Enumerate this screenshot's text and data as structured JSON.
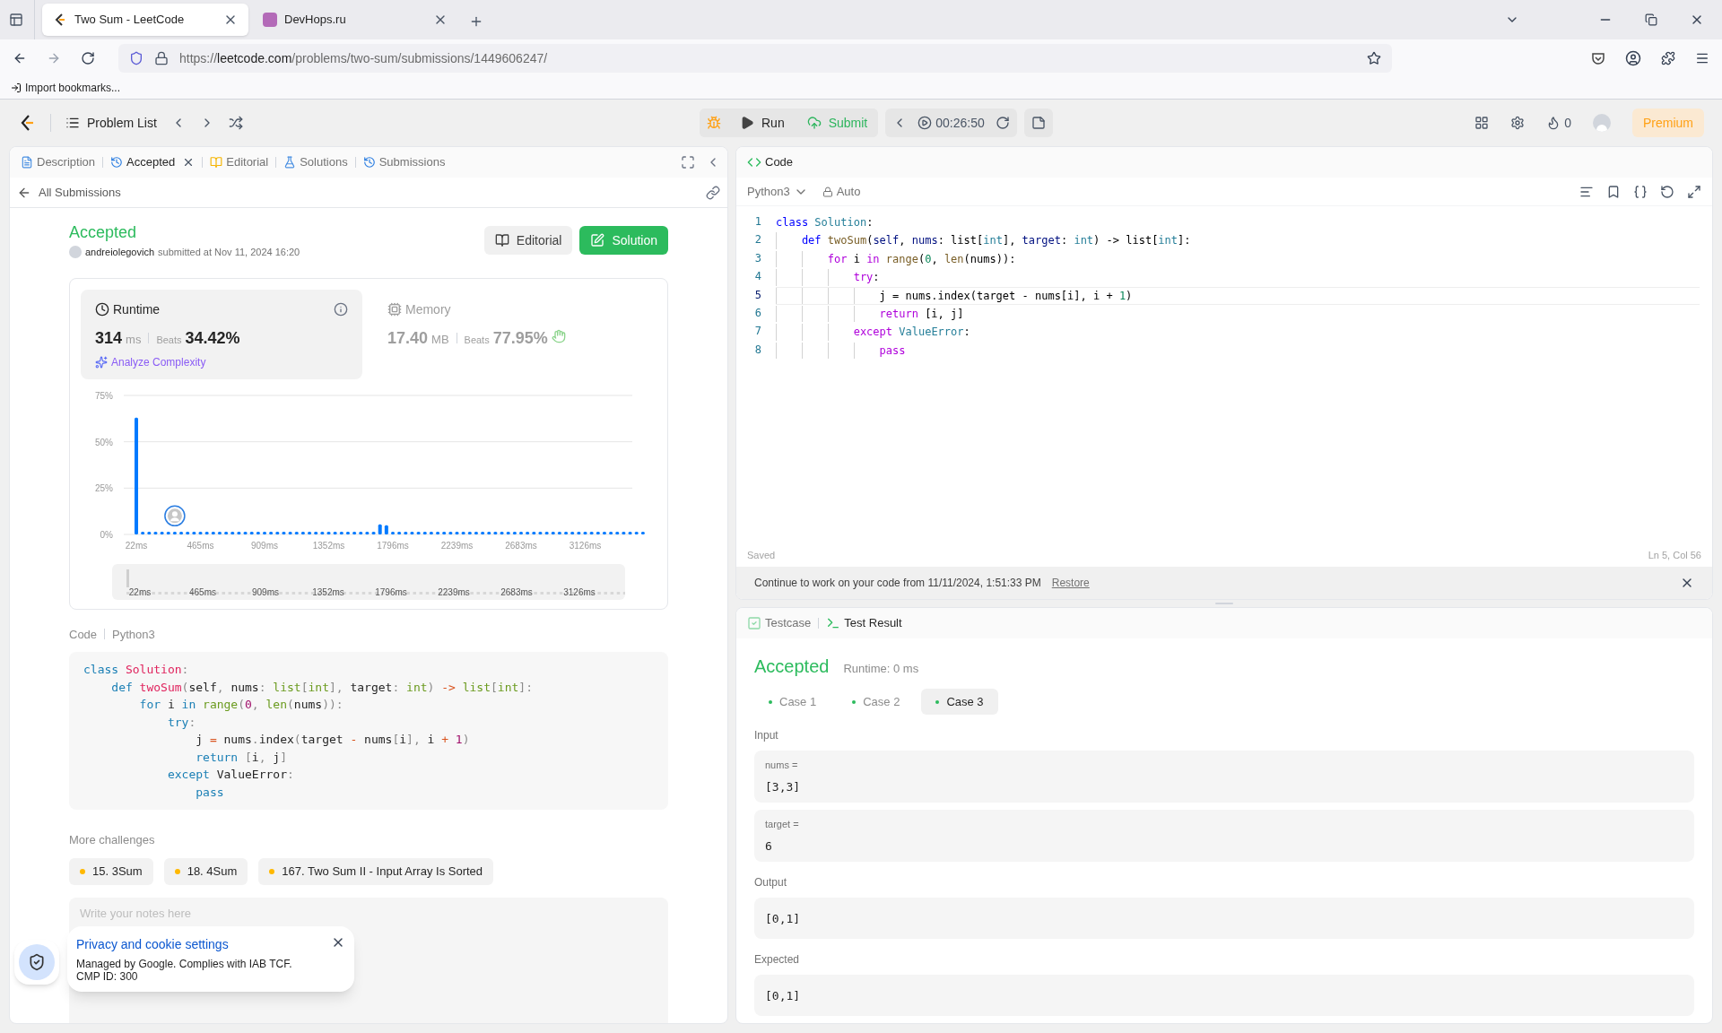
{
  "browser": {
    "tabs": [
      {
        "title": "Two Sum - LeetCode",
        "selected": true
      },
      {
        "title": "DevHops.ru",
        "selected": false
      }
    ],
    "url": {
      "scheme": "https://",
      "host": "leetcode.com",
      "path": "/problems/two-sum/submissions/1449606247/"
    },
    "bookmarks": [
      "Import bookmarks..."
    ]
  },
  "toolbar": {
    "problem_list": "Problem List",
    "run": "Run",
    "submit": "Submit",
    "timer": "00:26:50",
    "streak": "0",
    "premium": "Premium"
  },
  "left_panel": {
    "tabs": [
      {
        "label": "Description",
        "kind": "description",
        "selected": false,
        "closable": false
      },
      {
        "label": "Accepted",
        "kind": "history",
        "selected": true,
        "closable": true
      },
      {
        "label": "Editorial",
        "kind": "editorial",
        "selected": false,
        "closable": false
      },
      {
        "label": "Solutions",
        "kind": "solutions",
        "selected": false,
        "closable": false
      },
      {
        "label": "Submissions",
        "kind": "history",
        "selected": false,
        "closable": false
      }
    ],
    "back_link": "All Submissions",
    "submission": {
      "status": "Accepted",
      "user": "andreiolegovich",
      "submitted": "submitted at Nov 11, 2024 16:20",
      "buttons": [
        {
          "label": "Editorial",
          "kind": "secondary"
        },
        {
          "label": "Solution",
          "kind": "primary"
        }
      ]
    },
    "stats": [
      {
        "kind": "runtime",
        "label": "Runtime",
        "value": "314",
        "unit": "ms",
        "beats_label": "Beats",
        "beats": "34.42%",
        "link": "Analyze Complexity",
        "selected": true
      },
      {
        "kind": "memory",
        "label": "Memory",
        "value": "17.40",
        "unit": "MB",
        "beats_label": "Beats",
        "beats": "77.95%",
        "selected": false
      }
    ],
    "chart_data": {
      "type": "bar",
      "ylim": [
        0,
        75
      ],
      "yticks": [
        {
          "value": 0,
          "label": "0%"
        },
        {
          "value": 25,
          "label": "25%"
        },
        {
          "value": 50,
          "label": "50%"
        },
        {
          "value": 75,
          "label": "75%"
        }
      ],
      "categories": [
        "22ms",
        null,
        null,
        null,
        null,
        null,
        null,
        null,
        null,
        null,
        "465ms",
        null,
        null,
        null,
        null,
        null,
        null,
        null,
        null,
        null,
        "909ms",
        null,
        null,
        null,
        null,
        null,
        null,
        null,
        null,
        null,
        "1352ms",
        null,
        null,
        null,
        null,
        null,
        null,
        null,
        null,
        null,
        "1796ms",
        null,
        null,
        null,
        null,
        null,
        null,
        null,
        null,
        null,
        "2239ms",
        null,
        null,
        null,
        null,
        null,
        null,
        null,
        null,
        null,
        "2683ms",
        null,
        null,
        null,
        null,
        null,
        null,
        null,
        null,
        null,
        "3126ms",
        null,
        null,
        null,
        null,
        null,
        null,
        null,
        null,
        null
      ],
      "values": [
        63,
        1.5,
        1.5,
        1.5,
        1.5,
        1.5,
        1.5,
        1.5,
        1.5,
        1.5,
        1.5,
        1.5,
        1.5,
        1.5,
        1.5,
        1.5,
        1.5,
        1.5,
        1.5,
        1.5,
        1.5,
        1.5,
        1.5,
        1.5,
        1.5,
        1.5,
        1.5,
        1.5,
        1.5,
        1.5,
        1.5,
        1.5,
        1.5,
        1.5,
        1.5,
        1.5,
        1.5,
        1.5,
        5.5,
        5,
        1.5,
        1.5,
        1.5,
        1.5,
        1.5,
        1.5,
        1.5,
        1.5,
        1.5,
        1.5,
        1.5,
        1.5,
        1.5,
        1.5,
        1.5,
        1.5,
        1.5,
        1.5,
        1.5,
        1.5,
        1.5,
        1.5,
        1.5,
        1.5,
        1.5,
        1.5,
        1.5,
        1.5,
        1.5,
        1.5,
        1.5,
        1.5,
        1.5,
        1.5,
        1.5,
        1.5,
        1.5,
        1.5,
        1.5,
        1.5
      ]
    },
    "brush_labels": [
      "22ms",
      "465ms",
      "909ms",
      "1352ms",
      "1796ms",
      "2239ms",
      "2683ms",
      "3126ms"
    ],
    "code": {
      "label": "Code",
      "language": "Python3",
      "lines": [
        [
          {
            "text": "class",
            "kind": "kw"
          },
          {
            "text": " Solution",
            "kind": "cls"
          },
          {
            "text": ":",
            "kind": "p"
          }
        ],
        [
          {
            "text": "    def",
            "kind": "kw"
          },
          {
            "text": " twoSum",
            "kind": "fn"
          },
          {
            "text": "(",
            "kind": "p"
          },
          {
            "text": "self"
          },
          {
            "text": ",",
            "kind": "p"
          },
          {
            "text": " nums"
          },
          {
            "text": ":",
            "kind": "p"
          },
          {
            "text": " list",
            "kind": "type"
          },
          {
            "text": "[",
            "kind": "p"
          },
          {
            "text": "int",
            "kind": "type"
          },
          {
            "text": "],",
            "kind": "p"
          },
          {
            "text": " target"
          },
          {
            "text": ":",
            "kind": "p"
          },
          {
            "text": " int",
            "kind": "type"
          },
          {
            "text": ")",
            "kind": "p"
          },
          {
            "text": " ->",
            "kind": "op"
          },
          {
            "text": " list",
            "kind": "type"
          },
          {
            "text": "[",
            "kind": "p"
          },
          {
            "text": "int",
            "kind": "type"
          },
          {
            "text": "]:",
            "kind": "p"
          }
        ],
        [
          {
            "text": "        for",
            "kind": "kw"
          },
          {
            "text": " i"
          },
          {
            "text": " in",
            "kind": "kw"
          },
          {
            "text": " range",
            "kind": "type"
          },
          {
            "text": "(",
            "kind": "p"
          },
          {
            "text": "0",
            "kind": "num"
          },
          {
            "text": ",",
            "kind": "p"
          },
          {
            "text": " len",
            "kind": "type"
          },
          {
            "text": "(",
            "kind": "p"
          },
          {
            "text": "nums"
          },
          {
            "text": ")):",
            "kind": "p"
          }
        ],
        [
          {
            "text": "            try",
            "kind": "kw"
          },
          {
            "text": ":",
            "kind": "p"
          }
        ],
        [
          {
            "text": "                j"
          },
          {
            "text": " =",
            "kind": "op"
          },
          {
            "text": " nums"
          },
          {
            "text": ".",
            "kind": "p"
          },
          {
            "text": "index"
          },
          {
            "text": "(",
            "kind": "p"
          },
          {
            "text": "target"
          },
          {
            "text": " -",
            "kind": "op"
          },
          {
            "text": " nums"
          },
          {
            "text": "[",
            "kind": "p"
          },
          {
            "text": "i"
          },
          {
            "text": "],",
            "kind": "p"
          },
          {
            "text": " i"
          },
          {
            "text": " +",
            "kind": "op"
          },
          {
            "text": " 1",
            "kind": "num"
          },
          {
            "text": ")",
            "kind": "p"
          }
        ],
        [
          {
            "text": "                return",
            "kind": "kw"
          },
          {
            "text": " [",
            "kind": "p"
          },
          {
            "text": "i"
          },
          {
            "text": ",",
            "kind": "p"
          },
          {
            "text": " j"
          },
          {
            "text": "]",
            "kind": "p"
          }
        ],
        [
          {
            "text": "            except",
            "kind": "kw"
          },
          {
            "text": " ValueError"
          },
          {
            "text": ":",
            "kind": "p"
          }
        ],
        [
          {
            "text": "                pass",
            "kind": "kw"
          }
        ]
      ]
    },
    "more_challenges": {
      "title": "More challenges",
      "items": [
        "15. 3Sum",
        "18. 4Sum",
        "167. Two Sum II - Input Array Is Sorted"
      ]
    },
    "notes": {
      "placeholder": "Write your notes here"
    }
  },
  "cookie_popup": {
    "title": "Privacy and cookie settings",
    "text": "Managed by Google. Complies with IAB TCF. CMP ID: 300"
  },
  "editor": {
    "title": "Code",
    "language": "Python3",
    "mode": "Auto",
    "lines": [
      {
        "number": "1",
        "current": false,
        "tokens": [
          {
            "text": "class",
            "kind": "kw"
          },
          {
            "text": " Solution",
            "kind": "cls"
          },
          {
            "text": ":"
          }
        ]
      },
      {
        "number": "2",
        "current": false,
        "tokens": [
          {
            "text": "    def",
            "kind": "kw"
          },
          {
            "text": " twoSum",
            "kind": "fn"
          },
          {
            "text": "("
          },
          {
            "text": "self",
            "kind": "var"
          },
          {
            "text": ", "
          },
          {
            "text": "nums",
            "kind": "var"
          },
          {
            "text": ": list["
          },
          {
            "text": "int",
            "kind": "cls"
          },
          {
            "text": "], "
          },
          {
            "text": "target",
            "kind": "var"
          },
          {
            "text": ": "
          },
          {
            "text": "int",
            "kind": "cls"
          },
          {
            "text": ") -> list["
          },
          {
            "text": "int",
            "kind": "cls"
          },
          {
            "text": "]:"
          }
        ]
      },
      {
        "number": "3",
        "current": false,
        "tokens": [
          {
            "text": "        for",
            "kind": "ctl"
          },
          {
            "text": " i"
          },
          {
            "text": " in",
            "kind": "ctl"
          },
          {
            "text": " range",
            "kind": "fn"
          },
          {
            "text": "("
          },
          {
            "text": "0",
            "kind": "num"
          },
          {
            "text": ", "
          },
          {
            "text": "len",
            "kind": "fn"
          },
          {
            "text": "(nums)):"
          }
        ]
      },
      {
        "number": "4",
        "current": false,
        "tokens": [
          {
            "text": "            try",
            "kind": "ctl"
          },
          {
            "text": ":"
          }
        ]
      },
      {
        "number": "5",
        "current": true,
        "tokens": [
          {
            "text": "                j = nums.index(target - nums[i], i + "
          },
          {
            "text": "1",
            "kind": "num"
          },
          {
            "text": ")"
          }
        ]
      },
      {
        "number": "6",
        "current": false,
        "tokens": [
          {
            "text": "                return",
            "kind": "ctl"
          },
          {
            "text": " [i, j]"
          }
        ]
      },
      {
        "number": "7",
        "current": false,
        "tokens": [
          {
            "text": "            except",
            "kind": "ctl"
          },
          {
            "text": " ValueError",
            "kind": "cls"
          },
          {
            "text": ":"
          }
        ]
      },
      {
        "number": "8",
        "current": false,
        "tokens": [
          {
            "text": "                pass",
            "kind": "ctl"
          }
        ]
      }
    ],
    "status": "Saved",
    "cursor": "Ln 5, Col 56"
  },
  "restore_notice": {
    "text": "Continue to work on your code from 11/11/2024, 1:51:33 PM",
    "link": "Restore"
  },
  "test_panel": {
    "tabs": [
      {
        "label": "Testcase",
        "kind": "testcase",
        "selected": false
      },
      {
        "label": "Test Result",
        "kind": "result",
        "selected": true
      }
    ],
    "status": "Accepted",
    "runtime": "Runtime: 0 ms",
    "cases": [
      {
        "label": "Case 1",
        "selected": false
      },
      {
        "label": "Case 2",
        "selected": false
      },
      {
        "label": "Case 3",
        "selected": true
      }
    ],
    "input_label": "Input",
    "inputs": [
      {
        "name": "nums =",
        "value": "[3,3]"
      },
      {
        "name": "target =",
        "value": "6"
      }
    ],
    "output_label": "Output",
    "output": "[0,1]",
    "expected_label": "Expected",
    "expected": "[0,1]"
  }
}
